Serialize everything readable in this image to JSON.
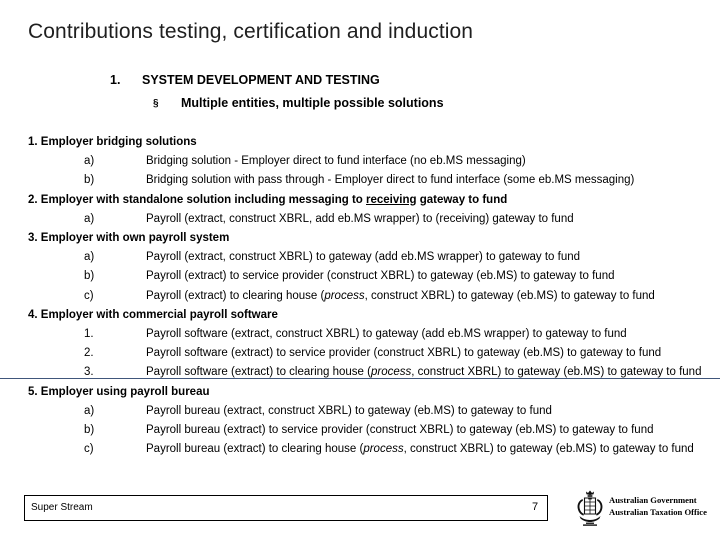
{
  "slide": {
    "title": "Contributions testing, certification and induction",
    "level1": {
      "number": "1.",
      "text": "SYSTEM DEVELOPMENT AND TESTING"
    },
    "level2": {
      "bullet": "§",
      "text": "Multiple entities, multiple possible solutions"
    },
    "sections": [
      {
        "heading": "1. Employer bridging solutions",
        "items": [
          {
            "marker": "a)",
            "text": "Bridging solution - Employer direct to fund interface (no eb.MS messaging)"
          },
          {
            "marker": "b)",
            "text": "Bridging solution with pass through - Employer direct to fund interface (some eb.MS messaging)"
          }
        ]
      },
      {
        "heading": "2. Employer with standalone solution including messaging to receiving gateway to fund",
        "heading_underline": "receiving",
        "items": [
          {
            "marker": "a)",
            "text": "Payroll (extract, construct XBRL, add eb.MS wrapper) to (receiving) gateway to fund"
          }
        ]
      },
      {
        "heading": "3. Employer with own payroll system",
        "items": [
          {
            "marker": "a)",
            "text": "Payroll (extract, construct XBRL) to gateway (add eb.MS wrapper) to gateway to fund"
          },
          {
            "marker": "b)",
            "text": "Payroll (extract) to service provider (construct XBRL) to gateway (eb.MS) to gateway to fund"
          },
          {
            "marker": "c)",
            "text": "Payroll (extract) to clearing house (process, construct XBRL) to gateway (eb.MS) to gateway to fund"
          }
        ]
      },
      {
        "heading": "4. Employer with commercial payroll software",
        "items": [
          {
            "marker": "1.",
            "text": "Payroll software (extract, construct XBRL) to gateway (add eb.MS wrapper) to gateway to fund"
          },
          {
            "marker": "2.",
            "text": "Payroll software (extract) to service provider (construct XBRL) to gateway (eb.MS) to gateway to fund"
          },
          {
            "marker": "3.",
            "text": "Payroll software (extract) to clearing house (process, construct XBRL) to gateway (eb.MS) to gateway to fund"
          }
        ]
      },
      {
        "heading": "5. Employer using payroll bureau",
        "items": [
          {
            "marker": "a)",
            "text": "Payroll bureau (extract, construct XBRL) to gateway (eb.MS) to gateway to fund"
          },
          {
            "marker": "b)",
            "text": "Payroll bureau (extract) to service provider (construct XBRL) to gateway (eb.MS) to gateway to fund"
          },
          {
            "marker": "c)",
            "text": "Payroll bureau (extract) to clearing house (process, construct XBRL) to gateway (eb.MS) to gateway to fund"
          }
        ]
      }
    ],
    "footer": {
      "label": "Super Stream",
      "page_number": "7",
      "crest": {
        "line1": "Australian Government",
        "line2": "Australian Taxation Office",
        "emblem_name": "australian-coat-of-arms"
      }
    },
    "colors": {
      "title": "#1f1f1f",
      "rule": "#1f3864",
      "text": "#000000"
    }
  }
}
